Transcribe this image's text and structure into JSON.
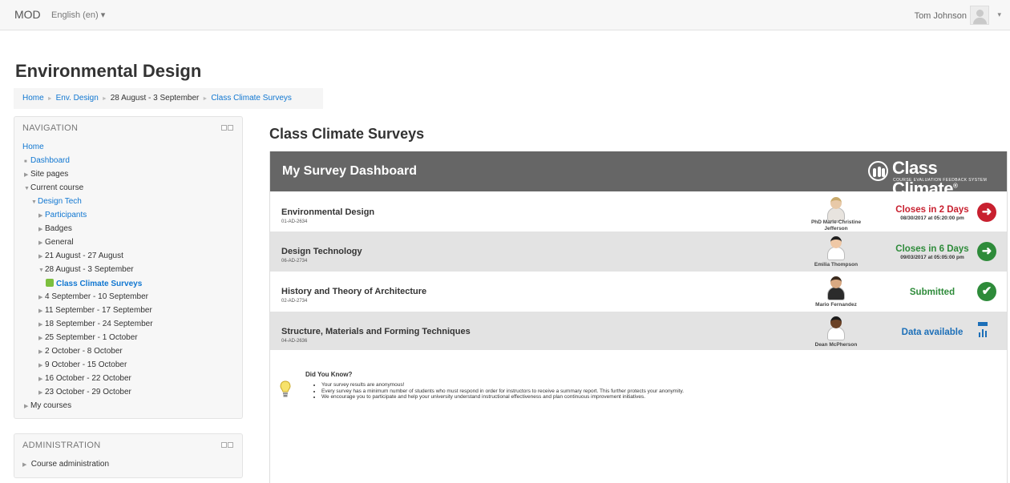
{
  "topbar": {
    "brand": "MOD",
    "language": "English (en) ▾",
    "user_name": "Tom Johnson",
    "menu_caret": "▾"
  },
  "page": {
    "heading": "Environmental Design"
  },
  "breadcrumb": [
    {
      "label": "Home",
      "link": true
    },
    {
      "label": "Env. Design",
      "link": true
    },
    {
      "label": "28 August - 3 September",
      "link": false
    },
    {
      "label": "Class Climate Surveys",
      "link": true
    }
  ],
  "breadcrumb_separator": "►",
  "navigation": {
    "title": "NAVIGATION",
    "items": [
      {
        "label": "Home",
        "marker": "",
        "link": true
      },
      {
        "label": "Dashboard",
        "marker": "■",
        "link": true
      },
      {
        "label": "Site pages",
        "marker": "▶",
        "link": false
      },
      {
        "label": "Current course",
        "marker": "▼",
        "link": false
      },
      {
        "label": "Design Tech",
        "marker": "▼",
        "link": true
      },
      {
        "label": "Participants",
        "marker": "▶",
        "link": true
      },
      {
        "label": "Badges",
        "marker": "▶",
        "link": false
      },
      {
        "label": "General",
        "marker": "▶",
        "link": false
      },
      {
        "label": "21 August - 27 August",
        "marker": "▶",
        "link": false
      },
      {
        "label": "28 August - 3 September",
        "marker": "▼",
        "link": false
      },
      {
        "label": "Class Climate Surveys",
        "marker": "",
        "link": true,
        "active": true
      },
      {
        "label": "4 September - 10 September",
        "marker": "▶",
        "link": false
      },
      {
        "label": "11 September - 17 September",
        "marker": "▶",
        "link": false
      },
      {
        "label": "18 September - 24 September",
        "marker": "▶",
        "link": false
      },
      {
        "label": "25 September - 1 October",
        "marker": "▶",
        "link": false
      },
      {
        "label": "2 October - 8 October",
        "marker": "▶",
        "link": false
      },
      {
        "label": "9 October - 15 October",
        "marker": "▶",
        "link": false
      },
      {
        "label": "16 October - 22 October",
        "marker": "▶",
        "link": false
      },
      {
        "label": "23 October - 29 October",
        "marker": "▶",
        "link": false
      },
      {
        "label": "My courses",
        "marker": "▶",
        "link": false
      }
    ]
  },
  "administration": {
    "title": "ADMINISTRATION",
    "items": [
      {
        "label": "Course administration",
        "marker": "▶"
      }
    ]
  },
  "main": {
    "title": "Class Climate Surveys"
  },
  "dashboard": {
    "title": "My Survey Dashboard",
    "logo_text": "Class Climate",
    "logo_mark": "®",
    "logo_subtitle": "COURSE EVALUATION FEEDBACK SYSTEM",
    "rows": [
      {
        "course": "Environmental Design",
        "code": "01-AD-2634",
        "instructor": "PhD Marie-Christine Jefferson",
        "status": "Closes in 2 Days",
        "date": "08/30/2017 at 05:20:00 pm",
        "status_color": "#c8202f",
        "action": "arrow",
        "action_color": "#c8202f",
        "gray": false
      },
      {
        "course": "Design Technology",
        "code": "06-AD-2734",
        "instructor": "Emilia Thompson",
        "status": "Closes in 6 Days",
        "date": "09/03/2017 at 05:05:00 pm",
        "status_color": "#2e8b3a",
        "action": "arrow",
        "action_color": "#2e8b3a",
        "gray": true
      },
      {
        "course": "History and Theory of Architecture",
        "code": "02-AD-2734",
        "instructor": "Mario Fernandez",
        "status": "Submitted",
        "date": "",
        "status_color": "#2e8b3a",
        "action": "check",
        "action_color": "#2e8b3a",
        "gray": false
      },
      {
        "course": "Structure, Materials and Forming Techniques",
        "code": "04-AD-2636",
        "instructor": "Dean McPherson",
        "status": "Data available",
        "date": "",
        "status_color": "#1c6fb8",
        "action": "chart",
        "action_color": "#1c6fb8",
        "gray": true
      }
    ]
  },
  "did_you_know": {
    "title": "Did You Know?",
    "items": [
      "Your survey results are anonymous!",
      "Every survey has a minimum number of students who must respond in order for instructors to receive a summary report. This further protects your anonymity.",
      "We encourage you to participate and help your university understand instructional effectiveness and plan continuous improvement initiatives."
    ]
  }
}
